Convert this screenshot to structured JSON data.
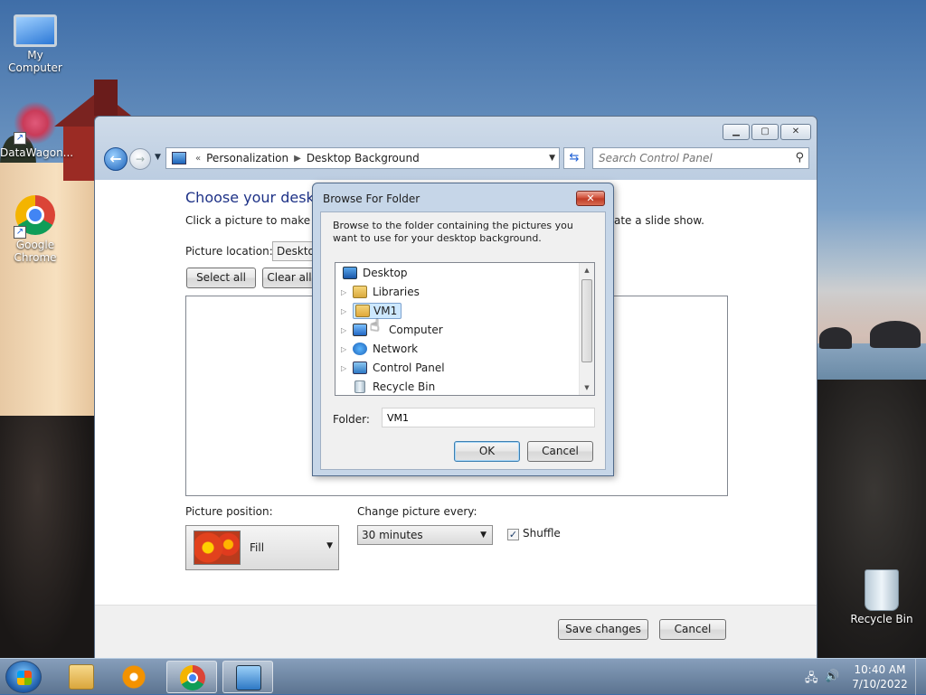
{
  "desktop": {
    "icons": [
      {
        "label": "My Computer",
        "icon": "computer-icon"
      },
      {
        "label": "DataWagon...",
        "icon": "datawagon-icon"
      },
      {
        "label": "Google Chrome",
        "icon": "chrome-icon"
      },
      {
        "label": "Recycle Bin",
        "icon": "recycle-bin-icon"
      }
    ]
  },
  "window": {
    "breadcrumb": [
      "Personalization",
      "Desktop Background"
    ],
    "breadcrumb_sep": "▶",
    "back_glyph": "←",
    "search_placeholder": "Search Control Panel",
    "title": "Choose your desktop",
    "subtitle_left": "Click a picture to make it y",
    "subtitle_right": "ate a slide show.",
    "picture_location_label": "Picture location:",
    "picture_location_value": "Desktop",
    "select_all": "Select all",
    "clear_all": "Clear all",
    "picture_position_label": "Picture position:",
    "picture_position_value": "Fill",
    "change_picture_label": "Change picture every:",
    "change_picture_value": "30 minutes",
    "shuffle_label": "Shuffle",
    "shuffle_checked": true,
    "save_changes": "Save changes",
    "cancel": "Cancel"
  },
  "dialog": {
    "title": "Browse For Folder",
    "description": "Browse to the folder containing the pictures you want to use for your desktop background.",
    "tree": [
      {
        "label": "Desktop",
        "icon": "desktop-icon",
        "expander": false,
        "selected": false
      },
      {
        "label": "Libraries",
        "icon": "libraries-icon",
        "expander": true,
        "selected": false
      },
      {
        "label": "VM1",
        "icon": "user-folder-icon",
        "expander": true,
        "selected": true
      },
      {
        "label": "Computer",
        "icon": "computer-icon",
        "expander": true,
        "selected": false
      },
      {
        "label": "Network",
        "icon": "network-icon",
        "expander": true,
        "selected": false
      },
      {
        "label": "Control Panel",
        "icon": "control-panel-icon",
        "expander": true,
        "selected": false
      },
      {
        "label": "Recycle Bin",
        "icon": "recycle-bin-icon",
        "expander": false,
        "selected": false
      }
    ],
    "folder_label": "Folder:",
    "folder_value": "VM1",
    "ok": "OK",
    "cancel": "Cancel"
  },
  "taskbar": {
    "time": "10:40 AM",
    "date": "7/10/2022",
    "items": [
      "windows-explorer-icon",
      "media-player-icon",
      "chrome-icon",
      "control-panel-icon"
    ]
  }
}
